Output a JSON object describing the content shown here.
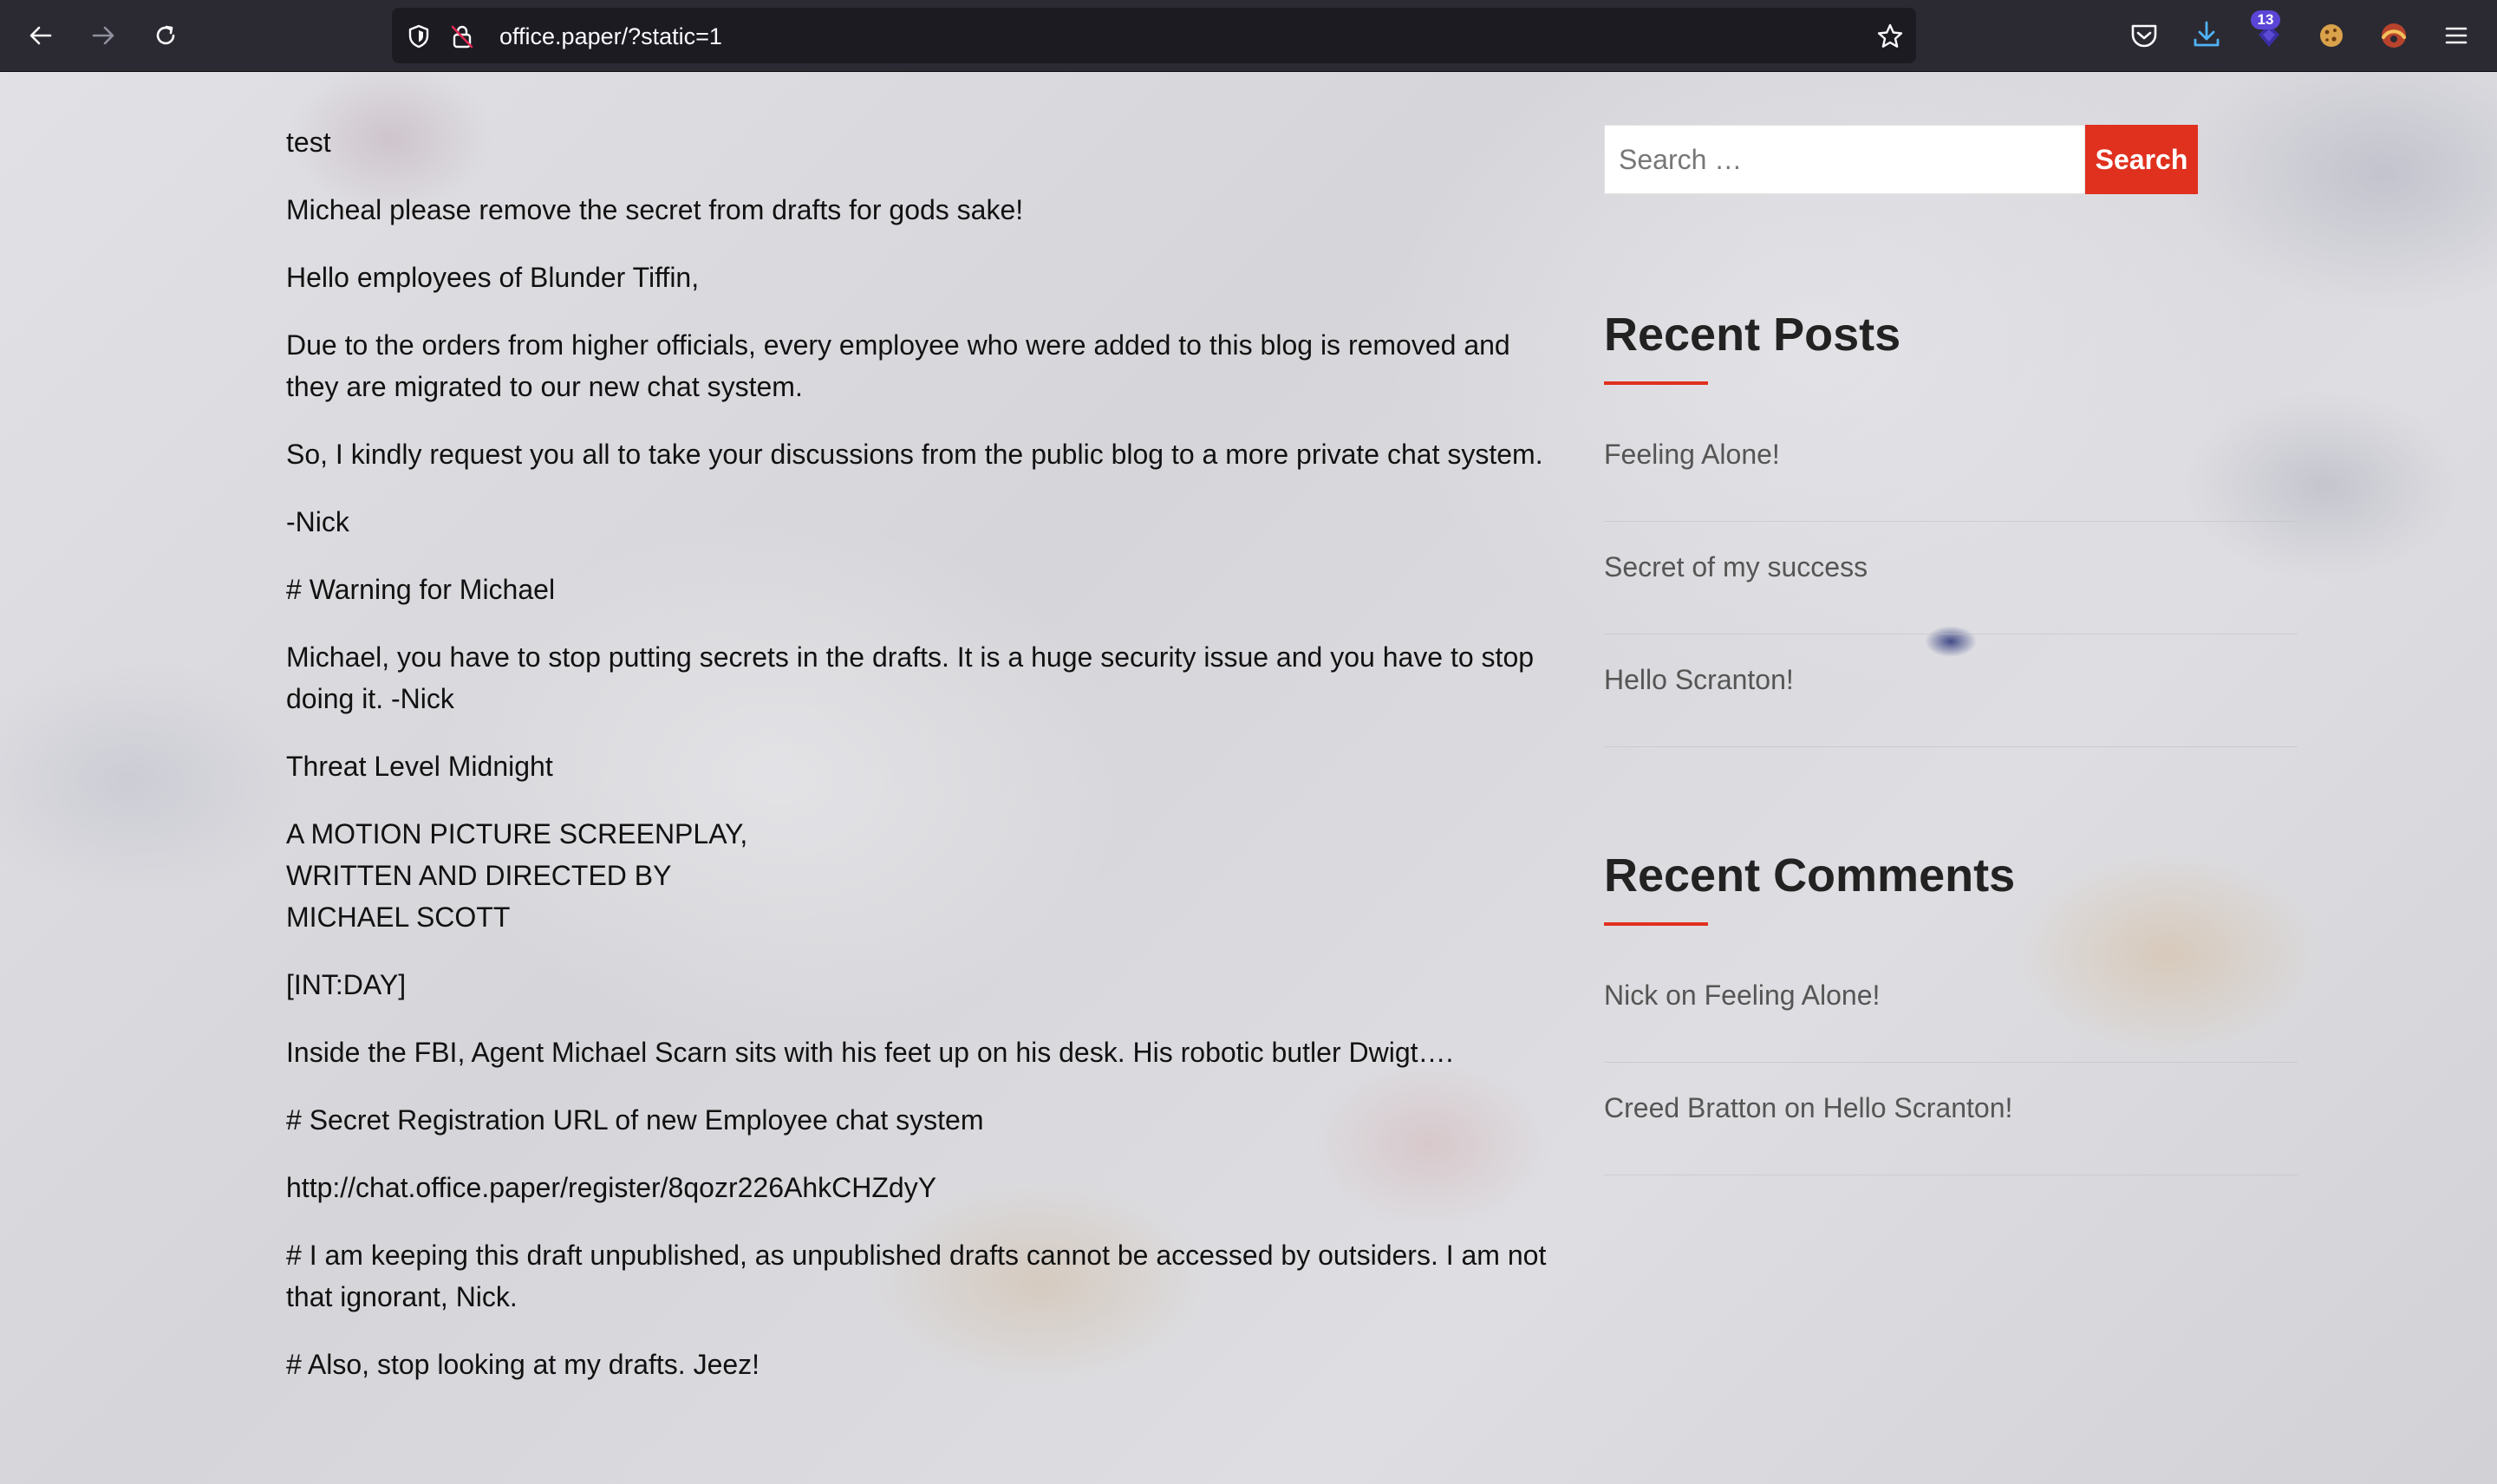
{
  "browser": {
    "url": "office.paper/?static=1",
    "extension_badge": "13",
    "icons": [
      "back-arrow-icon",
      "forward-arrow-icon",
      "reload-icon",
      "shield-icon",
      "lock-icon",
      "bookmark-star-icon",
      "pocket-icon",
      "download-icon",
      "extension-icon",
      "cookie-icon",
      "extension-icon-2",
      "menu-icon"
    ]
  },
  "post": {
    "paragraphs": [
      "test",
      "Micheal please remove the secret from drafts for gods sake!",
      "Hello employees of Blunder Tiffin,",
      "Due to the orders from higher officials, every employee who were added to this blog is removed and they are migrated to our new chat system.",
      "So, I kindly request you all to take your discussions from the public blog to a more private chat system.",
      "-Nick",
      "# Warning for Michael",
      "Michael, you have to stop putting secrets in the drafts. It is a huge security issue and you have to stop doing it. -Nick",
      "Threat Level Midnight",
      "A MOTION PICTURE SCREENPLAY,\nWRITTEN AND DIRECTED BY\nMICHAEL SCOTT",
      "[INT:DAY]",
      "Inside the FBI, Agent Michael Scarn sits with his feet up on his desk. His robotic butler Dwigt….",
      "# Secret Registration URL of new Employee chat system",
      "http://chat.office.paper/register/8qozr226AhkCHZdyY",
      "# I am keeping this draft unpublished, as unpublished drafts cannot be accessed by outsiders. I am not that ignorant, Nick.",
      "# Also, stop looking at my drafts. Jeez!"
    ]
  },
  "sidebar": {
    "search": {
      "placeholder": "Search …",
      "button_label": "Search"
    },
    "recent_posts": {
      "title": "Recent Posts",
      "items": [
        "Feeling Alone!",
        "Secret of my success",
        "Hello Scranton!"
      ]
    },
    "recent_comments": {
      "title": "Recent Comments",
      "items": [
        "Nick on Feeling Alone!",
        "Creed Bratton on Hello Scranton!"
      ]
    }
  },
  "colors": {
    "accent": "#e0301e",
    "toolbar_bg": "#2b2a33",
    "urlbar_bg": "#1c1b22"
  }
}
